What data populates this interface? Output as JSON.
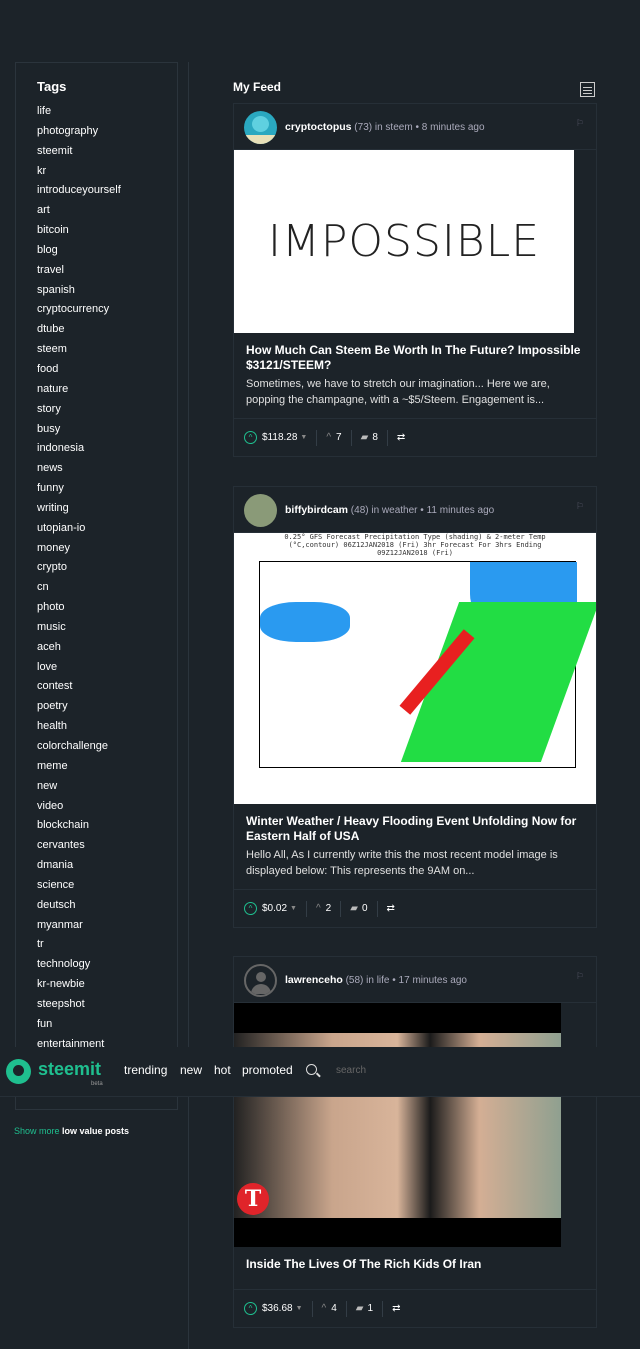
{
  "sidebar": {
    "title": "Tags",
    "tags": [
      "life",
      "photography",
      "steemit",
      "kr",
      "introduceyourself",
      "art",
      "bitcoin",
      "blog",
      "travel",
      "spanish",
      "cryptocurrency",
      "dtube",
      "steem",
      "food",
      "nature",
      "story",
      "busy",
      "indonesia",
      "news",
      "funny",
      "writing",
      "utopian-io",
      "money",
      "crypto",
      "cn",
      "photo",
      "music",
      "aceh",
      "love",
      "contest",
      "poetry",
      "health",
      "colorchallenge",
      "meme",
      "new",
      "video",
      "blockchain",
      "cervantes",
      "dmania",
      "science",
      "deutsch",
      "myanmar",
      "tr",
      "technology",
      "kr-newbie",
      "steepshot",
      "fun",
      "entertainment"
    ]
  },
  "show_more": {
    "a": "Show more",
    "b": "low value posts"
  },
  "feed": {
    "title": "My Feed"
  },
  "posts": [
    {
      "author": "cryptoctopus",
      "rep": "(73)",
      "in": "in steem",
      "time": "• 8 minutes ago",
      "image_text": "IMPOSSIBLE",
      "title": "How Much Can Steem Be Worth In The Future? Impossible $3121/STEEM?",
      "desc": "Sometimes, we have to stretch our imagination... Here we are, popping the champagne, with a ~$5/Steem. Engagement is...",
      "payout": "$118.28",
      "votes": "7",
      "comments": "8"
    },
    {
      "author": "biffybirdcam",
      "rep": "(48)",
      "in": "in weather",
      "time": "• 11 minutes ago",
      "image_text": "0.25° GFS Forecast Precipitation Type (shading) & 2-meter Temp (°C,contour) 06Z12JAN2018 (Fri) 3hr Forecast For 3hrs Ending 09Z12JAN2018 (Fri)",
      "title": "Winter Weather / Heavy Flooding Event Unfolding Now for Eastern Half of USA",
      "desc": "Hello All, As I currently write this the most recent model image is displayed below: This represents the 9AM on...",
      "payout": "$0.02",
      "votes": "2",
      "comments": "0"
    },
    {
      "author": "lawrenceho",
      "rep": "(58)",
      "in": "in life",
      "time": "• 17 minutes ago",
      "title": "Inside The Lives Of The Rich Kids Of Iran",
      "desc": "",
      "payout": "$36.68",
      "votes": "4",
      "comments": "1"
    }
  ],
  "topbar": {
    "brand": "steemit",
    "beta": "beta",
    "nav": [
      "trending",
      "new",
      "hot",
      "promoted"
    ],
    "search_placeholder": "search"
  },
  "colors": {
    "accent": "#1fbf8f",
    "background": "#1c2329"
  }
}
